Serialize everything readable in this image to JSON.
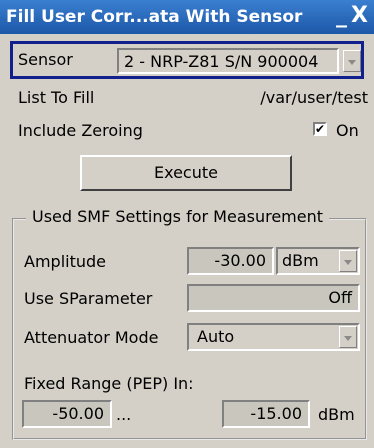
{
  "window": {
    "title": "Fill User Corr...ata With Sensor",
    "close_glyph": "X",
    "minimize_glyph": "_"
  },
  "sensor": {
    "label": "Sensor",
    "value": "2 - NRP-Z81 S/N 900004"
  },
  "list_to_fill": {
    "label": "List To Fill",
    "value": "/var/user/test"
  },
  "include_zeroing": {
    "label": "Include Zeroing",
    "checked": true,
    "check_glyph": "✔",
    "state_label": "On"
  },
  "execute": {
    "label": "Execute"
  },
  "settings_group": {
    "title": "Used SMF Settings for Measurement",
    "amplitude": {
      "label": "Amplitude",
      "value": "-30.00",
      "unit": "dBm"
    },
    "use_sparameter": {
      "label": "Use SParameter",
      "value": "Off"
    },
    "attenuator_mode": {
      "label": "Attenuator Mode",
      "value": "Auto"
    },
    "fixed_range": {
      "label": "Fixed Range (PEP) In:",
      "from": "-50.00",
      "separator": "...",
      "to": "-15.00",
      "unit": "dBm"
    }
  }
}
